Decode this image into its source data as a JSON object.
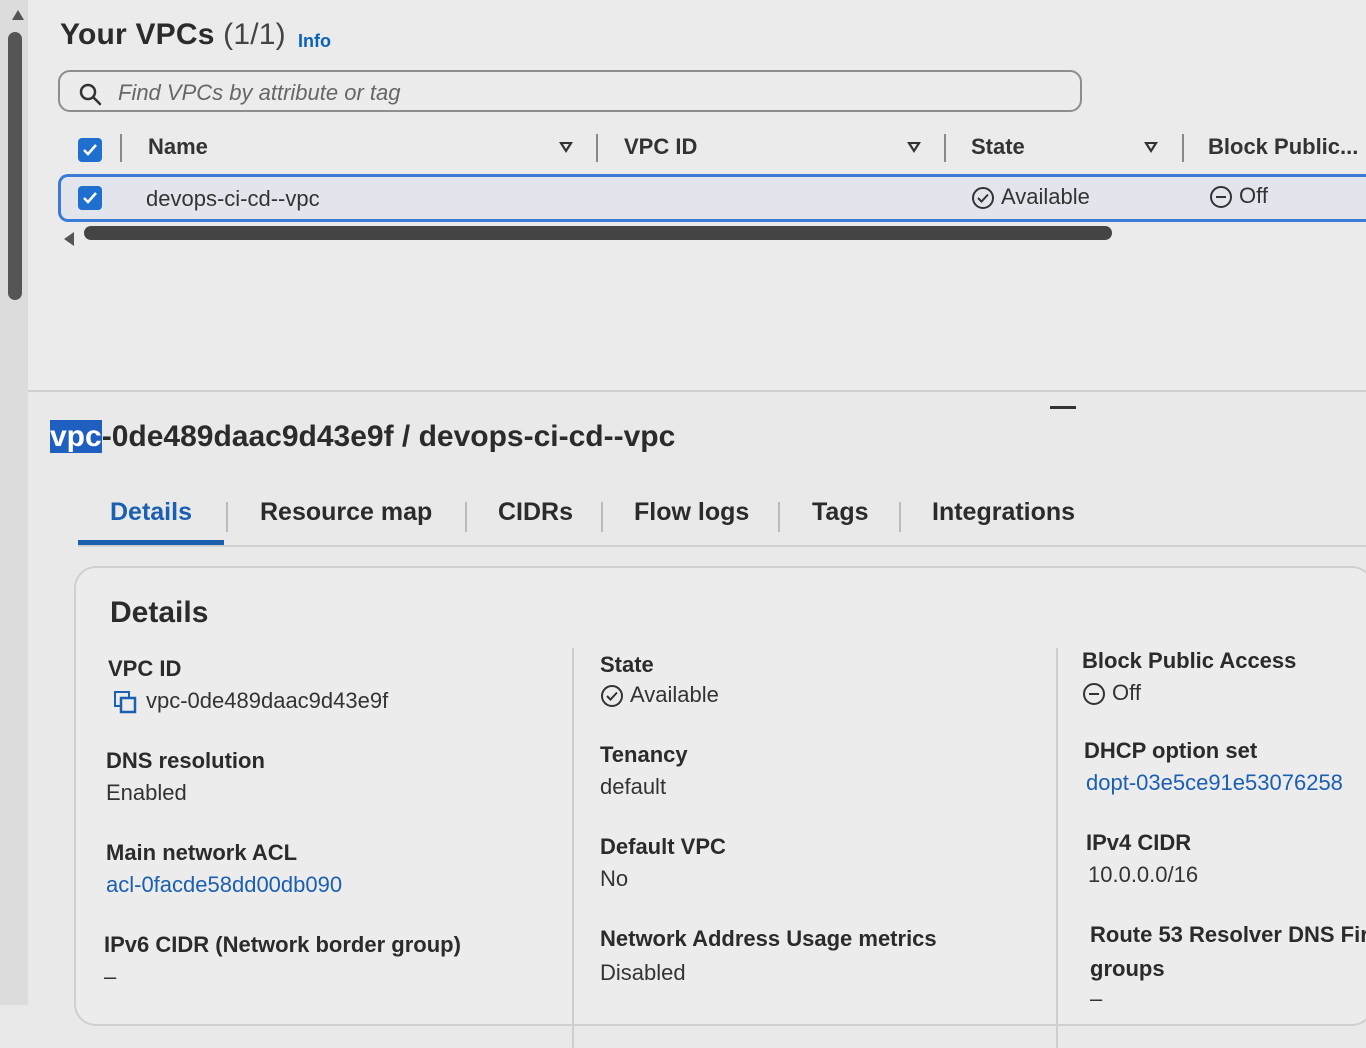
{
  "vpc_list": {
    "title": "Your VPCs",
    "count": "(1/1)",
    "info": "Info",
    "search_placeholder": "Find VPCs by attribute or tag",
    "columns": [
      "Name",
      "VPC ID",
      "State",
      "Block Public..."
    ],
    "rows": [
      {
        "name": "devops-ci-cd--vpc",
        "vpc_id": "",
        "state": "Available",
        "block_public": "Off"
      }
    ]
  },
  "detail": {
    "title_prefix": "vpc",
    "title_rest": "-0de489daac9d43e9f / devops-ci-cd--vpc",
    "tabs": [
      "Details",
      "Resource map",
      "CIDRs",
      "Flow logs",
      "Tags",
      "Integrations"
    ],
    "active_tab": "Details"
  },
  "details_card": {
    "title": "Details",
    "vpc_id_label": "VPC ID",
    "vpc_id_value": "vpc-0de489daac9d43e9f",
    "state_label": "State",
    "state_value": "Available",
    "bpa_label": "Block Public Access",
    "bpa_value": "Off",
    "dns_label": "DNS resolution",
    "dns_value": "Enabled",
    "tenancy_label": "Tenancy",
    "tenancy_value": "default",
    "dhcp_label": "DHCP option set",
    "dhcp_value": "dopt-03e5ce91e53076258",
    "acl_label": "Main network ACL",
    "acl_value": "acl-0facde58dd00db090",
    "default_vpc_label": "Default VPC",
    "default_vpc_value": "No",
    "ipv4_label": "IPv4 CIDR",
    "ipv4_value": "10.0.0.0/16",
    "ipv6_label": "IPv6 CIDR (Network border group)",
    "ipv6_value": "–",
    "nau_label": "Network Address Usage metrics",
    "nau_value": "Disabled",
    "r53_label": "Route 53 Resolver DNS Fir",
    "r53_label2": "groups",
    "r53_value": "–"
  },
  "colors": {
    "accent": "#1a5fb0",
    "checkbox": "#1f6fd1",
    "selection": "#1f5fc0"
  }
}
